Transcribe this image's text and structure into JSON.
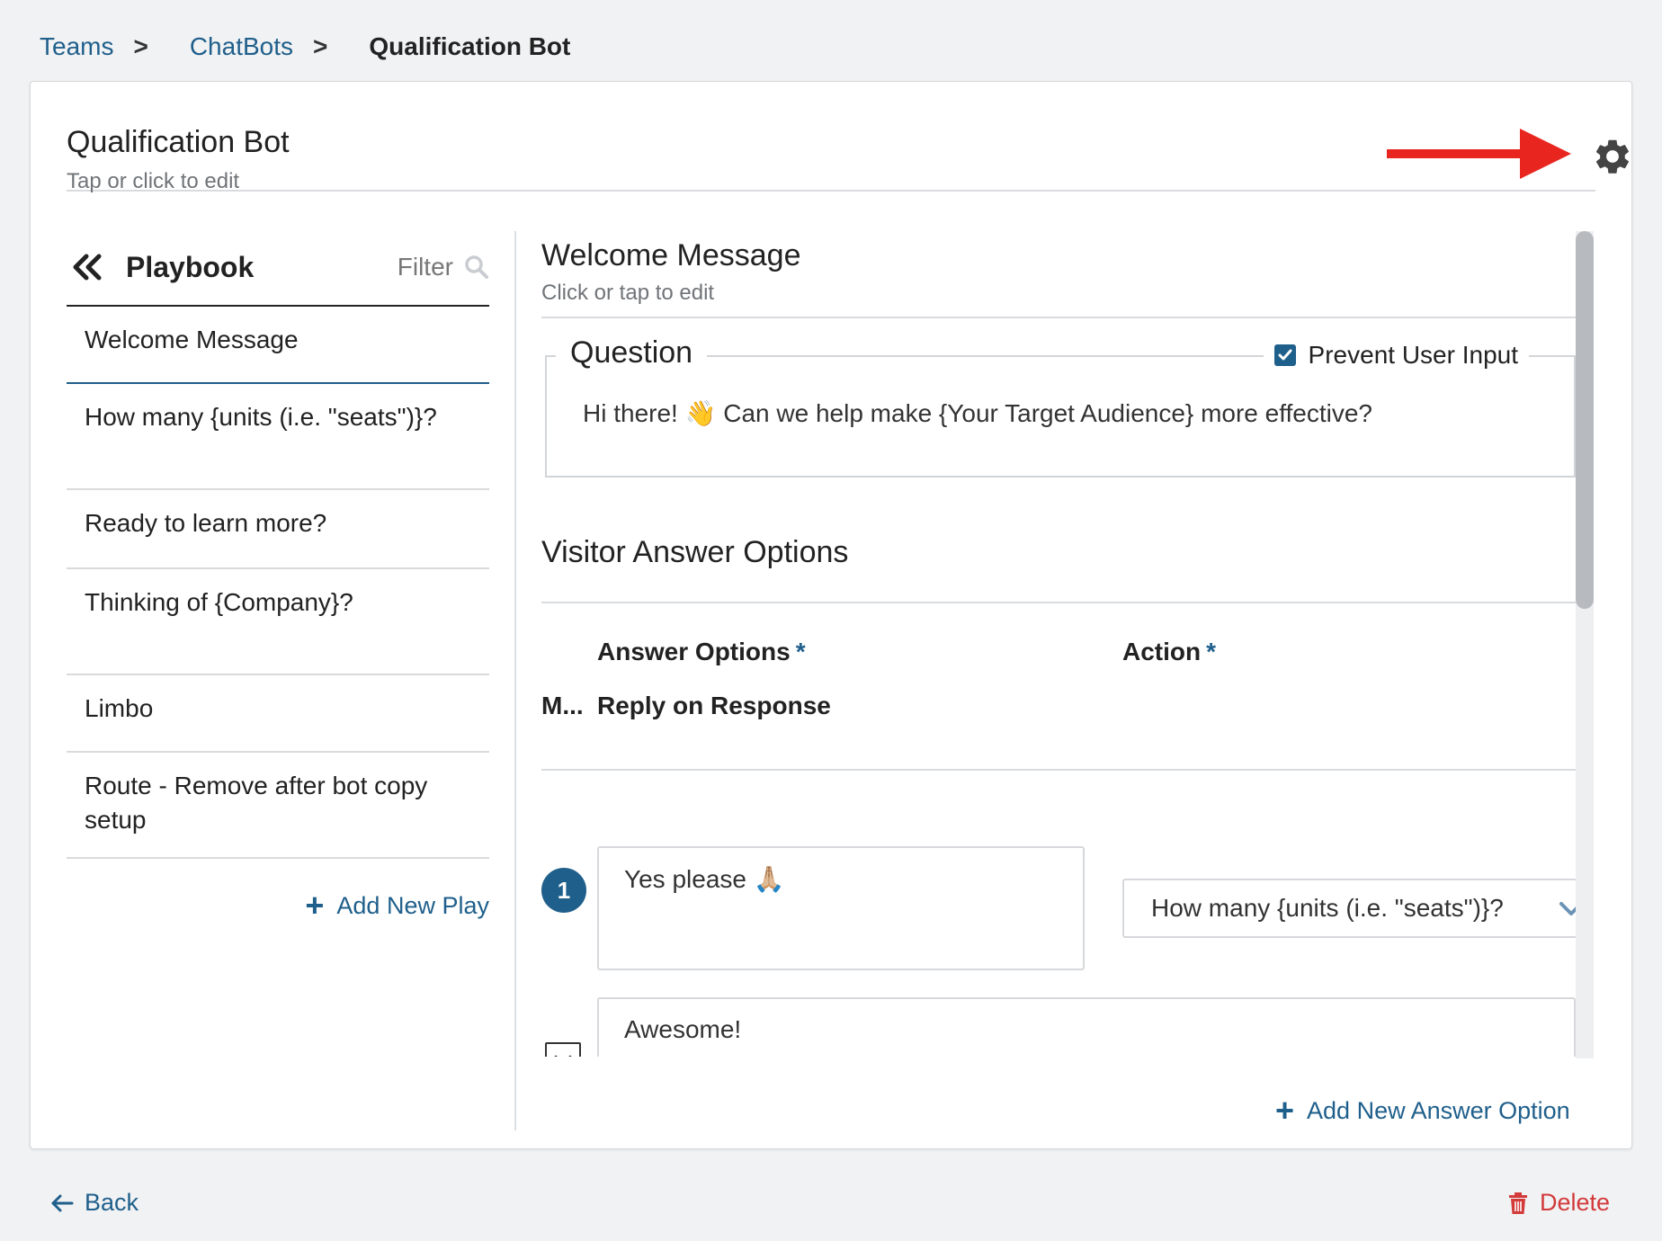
{
  "breadcrumb": {
    "items": [
      "Teams",
      "ChatBots"
    ],
    "separator": ">",
    "current": "Qualification Bot"
  },
  "header": {
    "title": "Qualification Bot",
    "subtitle": "Tap or click to edit",
    "settings_icon": "gear-icon",
    "annotation_arrow_color": "#e8261f"
  },
  "playbook": {
    "title": "Playbook",
    "filter_label": "Filter",
    "plays": [
      {
        "label": "Welcome Message",
        "active": true
      },
      {
        "label": "How many {units (i.e. \"seats\")}?"
      },
      {
        "label": "Ready to learn more?"
      },
      {
        "label": "Thinking of {Company}?"
      },
      {
        "label": "Limbo"
      },
      {
        "label": "Route - Remove after bot copy setup"
      }
    ],
    "add_label": "Add New Play"
  },
  "message": {
    "title": "Welcome Message",
    "subtitle": "Click or tap to edit",
    "question_label": "Question",
    "prevent_label": "Prevent User Input",
    "prevent_checked": true,
    "question_text": "Hi there! 👋  Can we help make {Your Target Audience} more effective?"
  },
  "answers": {
    "section_title": "Visitor Answer Options",
    "col_answer": "Answer Options",
    "col_action": "Action",
    "required_mark": "*",
    "row_prefix": "M...",
    "row_reply": "Reply on Response",
    "option_number": "1",
    "option_text": "Yes please 🙏🏼",
    "option_action": "How many {units (i.e. \"seats\")}?",
    "reply_text": "Awesome!",
    "add_label": "Add New Answer Option"
  },
  "footer": {
    "back_label": "Back",
    "delete_label": "Delete"
  },
  "colors": {
    "accent": "#1f5f8b",
    "danger": "#d33a3a",
    "arrow": "#e8261f"
  }
}
